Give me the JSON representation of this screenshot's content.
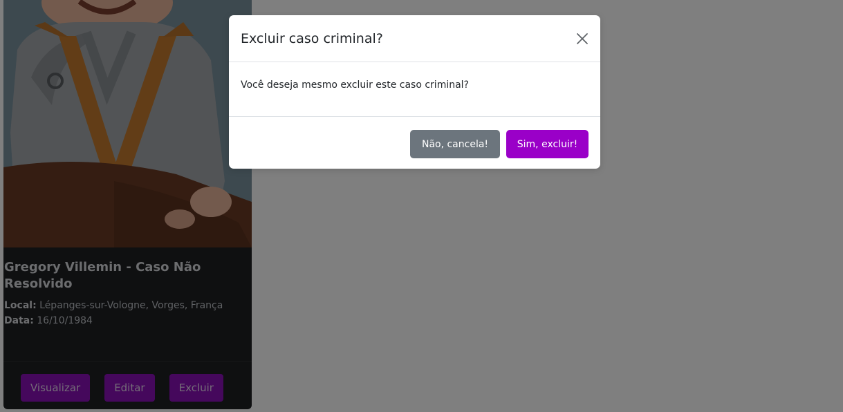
{
  "card": {
    "title": "Gregory Villemin - Caso Não Resolvido",
    "location_label": "Local:",
    "location_value": "Lépanges-sur-Vologne, Vorges, França",
    "date_label": "Data:",
    "date_value": "16/10/1984",
    "buttons": {
      "view": "Visualizar",
      "edit": "Editar",
      "delete": "Excluir"
    }
  },
  "modal": {
    "title": "Excluir caso criminal?",
    "message": "Você deseja mesmo excluir este caso criminal?",
    "cancel_label": "Não, cancela!",
    "confirm_label": "Sim, excluir!"
  },
  "colors": {
    "accent": "#9a00c8",
    "secondary": "#6c757d",
    "card_bg": "#1f2023",
    "backdrop": "rgba(0,0,0,0.5)"
  },
  "icons": {
    "close": "close-icon"
  }
}
